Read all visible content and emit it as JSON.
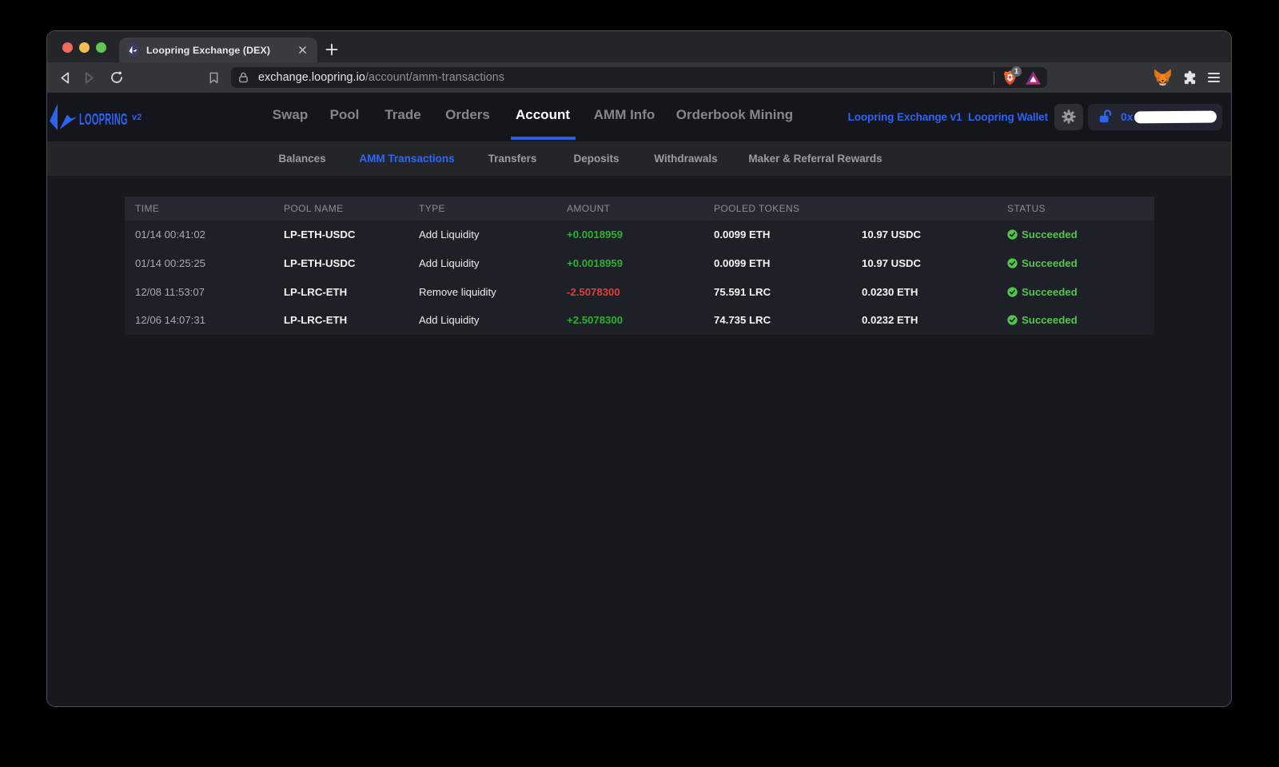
{
  "browser": {
    "tab": {
      "title": "Loopring Exchange (DEX)",
      "close_label": "✕",
      "new_tab_label": "+"
    },
    "toolbar": {
      "url_domain": "exchange.loopring.io",
      "url_path": "/account/amm-transactions",
      "shield_badge": "1"
    }
  },
  "site": {
    "logo": {
      "name": "LOOPRING",
      "version": "v2"
    },
    "nav": {
      "items": [
        {
          "label": "Swap"
        },
        {
          "label": "Pool"
        },
        {
          "label": "Trade"
        },
        {
          "label": "Orders"
        },
        {
          "label": "Account"
        },
        {
          "label": "AMM Info"
        },
        {
          "label": "Orderbook Mining"
        }
      ],
      "active": "Account"
    },
    "links": {
      "exchange_v1": "Loopring Exchange v1",
      "wallet": "Loopring Wallet"
    },
    "wallet_button": {
      "prefix": "0x"
    },
    "subnav": {
      "items": [
        {
          "label": "Balances"
        },
        {
          "label": "AMM Transactions"
        },
        {
          "label": "Transfers"
        },
        {
          "label": "Deposits"
        },
        {
          "label": "Withdrawals"
        },
        {
          "label": "Maker & Referral Rewards"
        }
      ],
      "active": "AMM Transactions"
    }
  },
  "table": {
    "columns": {
      "time": "TIME",
      "pool": "POOL NAME",
      "type": "TYPE",
      "amount": "AMOUNT",
      "pooled": "POOLED TOKENS",
      "status": "STATUS"
    },
    "rows": [
      {
        "time": "01/14 00:41:02",
        "pool": "LP-ETH-USDC",
        "type": "Add Liquidity",
        "amount": "+0.0018959",
        "pooled1": "0.0099 ETH",
        "pooled2": "10.97 USDC",
        "status": "Succeeded"
      },
      {
        "time": "01/14 00:25:25",
        "pool": "LP-ETH-USDC",
        "type": "Add Liquidity",
        "amount": "+0.0018959",
        "pooled1": "0.0099 ETH",
        "pooled2": "10.97 USDC",
        "status": "Succeeded"
      },
      {
        "time": "12/08 11:53:07",
        "pool": "LP-LRC-ETH",
        "type": "Remove liquidity",
        "amount": "-2.5078300",
        "pooled1": "75.591 LRC",
        "pooled2": "0.0230 ETH",
        "status": "Succeeded"
      },
      {
        "time": "12/06 14:07:31",
        "pool": "LP-LRC-ETH",
        "type": "Add Liquidity",
        "amount": "+2.5078300",
        "pooled1": "74.735 LRC",
        "pooled2": "0.0232 ETH",
        "status": "Succeeded"
      }
    ]
  },
  "colors": {
    "accent": "#2e62f3",
    "green": "#2fb032",
    "green_light": "#5cc75c",
    "red": "#e03d3d"
  }
}
